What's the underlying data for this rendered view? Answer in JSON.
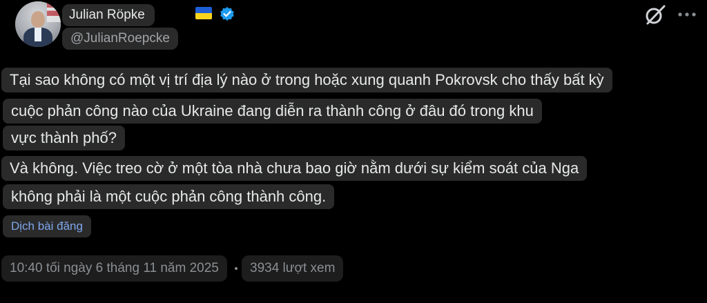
{
  "author": {
    "name": "Julian Röpke",
    "handle": "@JulianRoepcke",
    "flag_icon": "ukraine-flag-icon",
    "verified_icon": "verified-badge-icon",
    "verified_color": "#1d9bf0"
  },
  "toolbar": {
    "grok_icon": "grok-icon",
    "more_icon": "more-options-icon"
  },
  "tweet": {
    "lines": [
      "Tại sao không có một vị trí địa lý nào ở trong hoặc xung quanh Pokrovsk cho thấy bất kỳ",
      "cuộc phản công nào của Ukraine đang diễn ra thành công ở đâu đó trong khu",
      "vực thành phố?",
      "Và không. Việc treo cờ ở một tòa nhà chưa bao giờ nằm dưới sự kiểm soát của Nga",
      "không phải là một cuộc phản công thành công."
    ]
  },
  "translate_label": "Dịch bài đăng",
  "meta": {
    "timestamp": "10:40 tối ngày 6 tháng 11 năm 2025",
    "views": "3934 lượt xem"
  },
  "colors": {
    "background": "#000000",
    "text": "#e7e9ea",
    "link": "#7ea7ec",
    "highlight": "#2a2a2a"
  }
}
